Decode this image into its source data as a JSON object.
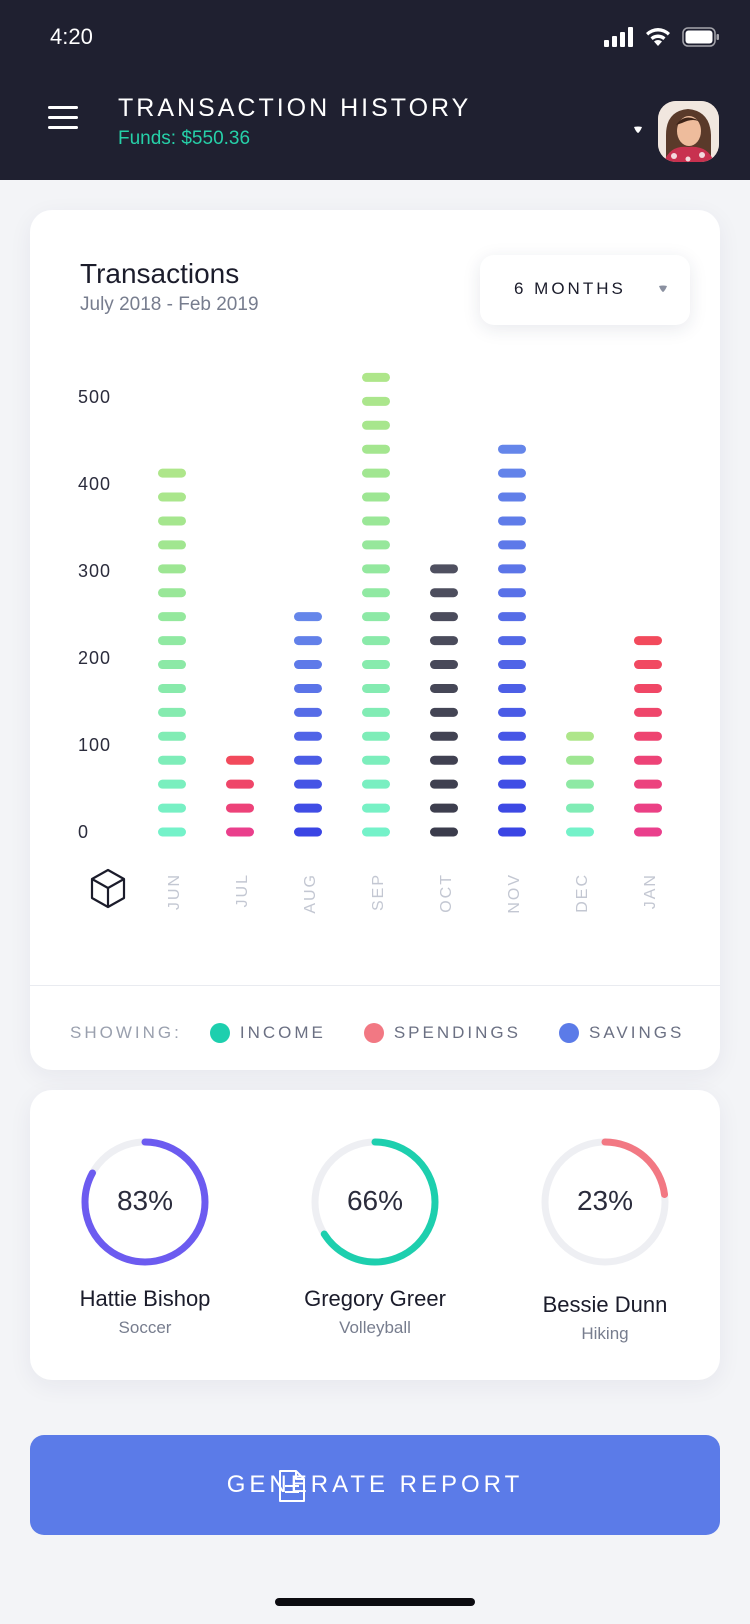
{
  "status_bar": {
    "time": "4:20"
  },
  "header": {
    "title": "TRANSACTION HISTORY",
    "funds": "Funds: $550.36"
  },
  "chart_card": {
    "title": "Transactions",
    "subtitle": "July 2018 - Feb 2019",
    "range_selector": "6 MONTHS",
    "legend_prefix": "SHOWING:",
    "legend": [
      {
        "label": "INCOME",
        "color": "#1dcfae"
      },
      {
        "label": "SPENDINGS",
        "color": "#f27883"
      },
      {
        "label": "SAVINGS",
        "color": "#5b7be8"
      }
    ]
  },
  "chart_data": {
    "type": "bar",
    "categories": [
      "JUN",
      "JUL",
      "AUG",
      "SEP",
      "OCT",
      "NOV",
      "DEC",
      "JAN"
    ],
    "values": [
      420,
      80,
      250,
      530,
      310,
      445,
      110,
      225
    ],
    "bar_palettes": [
      "income",
      "spendings",
      "savings",
      "income",
      "dark",
      "savings",
      "income",
      "spendings"
    ],
    "yticks": [
      0,
      100,
      200,
      300,
      400,
      500
    ],
    "ylim": [
      0,
      530
    ],
    "segment_step": 27.5
  },
  "progress": [
    {
      "name": "Hattie Bishop",
      "sport": "Soccer",
      "percent": 83,
      "percent_label": "83%",
      "color": "#6c5bf0"
    },
    {
      "name": "Gregory Greer",
      "sport": "Volleyball",
      "percent": 66,
      "percent_label": "66%",
      "color": "#1dcfae"
    },
    {
      "name": "Bessie Dunn",
      "sport": "Hiking",
      "percent": 23,
      "percent_label": "23%",
      "color": "#f27883"
    }
  ],
  "report_button": {
    "label": "GENERATE REPORT"
  }
}
